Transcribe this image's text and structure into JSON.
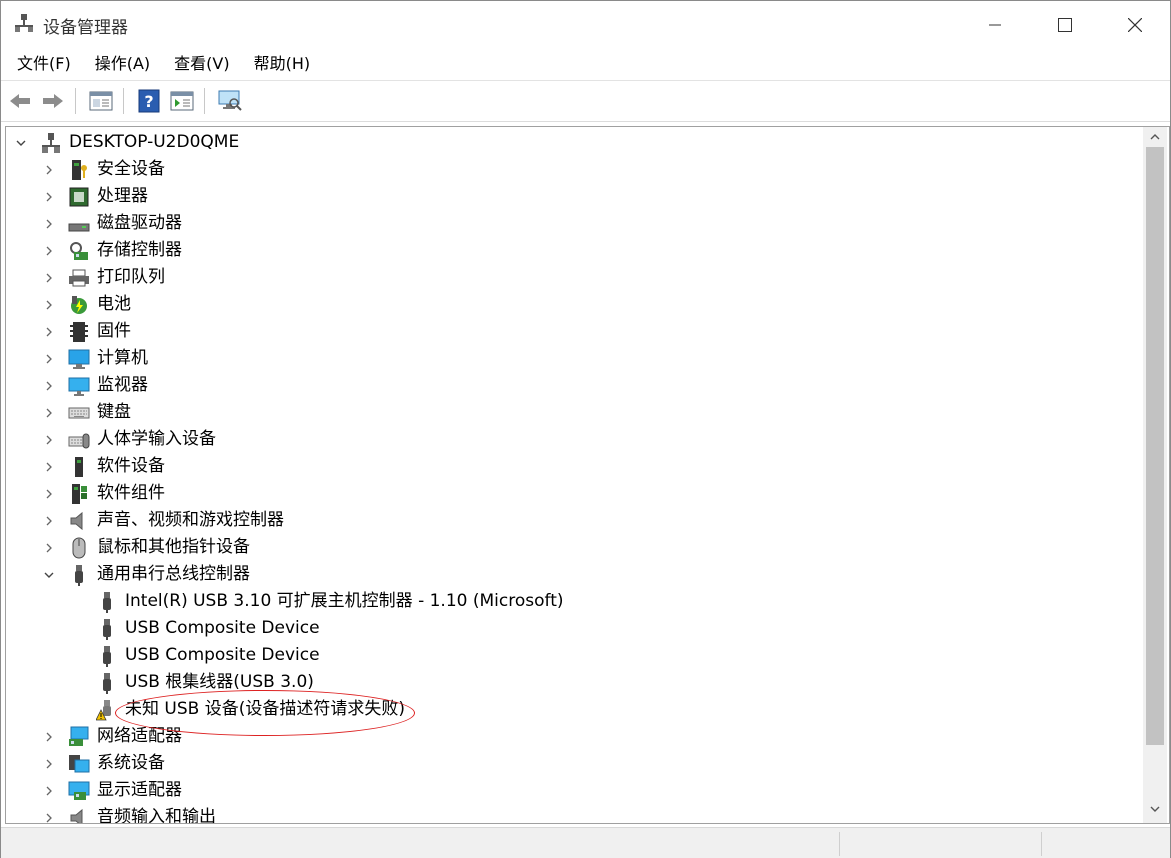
{
  "window": {
    "title": "设备管理器"
  },
  "menu": [
    "文件(F)",
    "操作(A)",
    "查看(V)",
    "帮助(H)"
  ],
  "toolbar": {
    "buttons": [
      "back-icon",
      "forward-icon",
      "properties-icon",
      "help-icon",
      "action-pane-icon",
      "scan-hardware-icon"
    ]
  },
  "tree": {
    "root": "DESKTOP-U2D0QME",
    "categories": [
      "安全设备",
      "处理器",
      "磁盘驱动器",
      "存储控制器",
      "打印队列",
      "电池",
      "固件",
      "计算机",
      "监视器",
      "键盘",
      "人体学输入设备",
      "软件设备",
      "软件组件",
      "声音、视频和游戏控制器",
      "鼠标和其他指针设备",
      "通用串行总线控制器"
    ],
    "usb_children": [
      "Intel(R) USB 3.10 可扩展主机控制器 - 1.10 (Microsoft)",
      "USB Composite Device",
      "USB Composite Device",
      "USB 根集线器(USB 3.0)",
      "未知 USB 设备(设备描述符请求失败)"
    ],
    "after_categories": [
      "网络适配器",
      "系统设备",
      "显示适配器",
      "音频输入和输出"
    ]
  },
  "colors": {
    "annotation": "#dd2222",
    "warning": "#f2c200"
  }
}
